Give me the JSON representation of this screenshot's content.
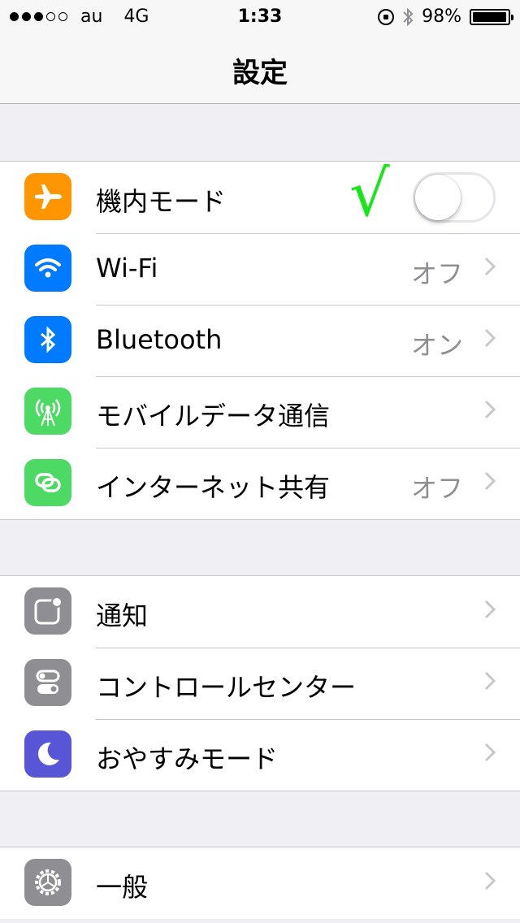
{
  "status_bar": {
    "signal_dots": [
      true,
      true,
      true,
      false,
      false
    ],
    "carrier": "au",
    "network": "4G",
    "time": "1:33",
    "battery_percent": "98%",
    "battery_level": 0.98,
    "icons": [
      "rotation-lock-icon",
      "bluetooth-icon",
      "battery-icon"
    ]
  },
  "nav": {
    "title": "設定"
  },
  "annotation": {
    "mark": "√",
    "color": "#19e619"
  },
  "groups": [
    {
      "rows": [
        {
          "label": "機内モード",
          "icon": "airplane-icon",
          "icon_color": "#ff9500",
          "control": "toggle",
          "toggle_on": false
        },
        {
          "label": "Wi-Fi",
          "icon": "wifi-icon",
          "icon_color": "#007aff",
          "value": "オフ"
        },
        {
          "label": "Bluetooth",
          "icon": "bluetooth-icon",
          "icon_color": "#007aff",
          "value": "オン"
        },
        {
          "label": "モバイルデータ通信",
          "icon": "cellular-antenna-icon",
          "icon_color": "#4cd964",
          "value": ""
        },
        {
          "label": "インターネット共有",
          "icon": "hotspot-chain-icon",
          "icon_color": "#4cd964",
          "value": "オフ"
        }
      ]
    },
    {
      "rows": [
        {
          "label": "通知",
          "icon": "notifications-icon",
          "icon_color": "#8e8e93"
        },
        {
          "label": "コントロールセンター",
          "icon": "control-center-icon",
          "icon_color": "#8e8e93"
        },
        {
          "label": "おやすみモード",
          "icon": "moon-icon",
          "icon_color": "#5856d6"
        }
      ]
    },
    {
      "rows": [
        {
          "label": "一般",
          "icon": "gear-icon",
          "icon_color": "#8e8e93"
        }
      ]
    }
  ]
}
